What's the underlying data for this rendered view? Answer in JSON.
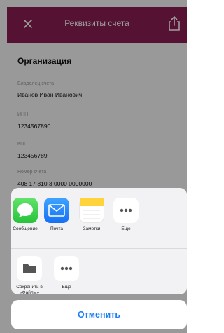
{
  "header": {
    "title": "Реквизиты счета"
  },
  "details": {
    "section_title": "Организация",
    "fields": [
      {
        "label": "Владелец счета",
        "value": "Иванов Иван Иванович"
      },
      {
        "label": "ИНН",
        "value": "1234567890"
      },
      {
        "label": "КПП",
        "value": "123456789"
      },
      {
        "label": "Номер счета",
        "value": "408 17 810 3 0000 0000000"
      }
    ]
  },
  "share_sheet": {
    "apps": [
      {
        "label": "Сообщение",
        "icon": "messages-icon"
      },
      {
        "label": "Почта",
        "icon": "mail-icon"
      },
      {
        "label": "Заметки",
        "icon": "notes-icon"
      },
      {
        "label": "Еще",
        "icon": "more-icon"
      }
    ],
    "actions": [
      {
        "label": "Сохранить в «Файлы»",
        "icon": "folder-icon"
      },
      {
        "label": "Еще",
        "icon": "more-icon"
      }
    ],
    "cancel_label": "Отменить"
  },
  "colors": {
    "header": "#8b1e52",
    "accent": "#1b7cf6"
  }
}
